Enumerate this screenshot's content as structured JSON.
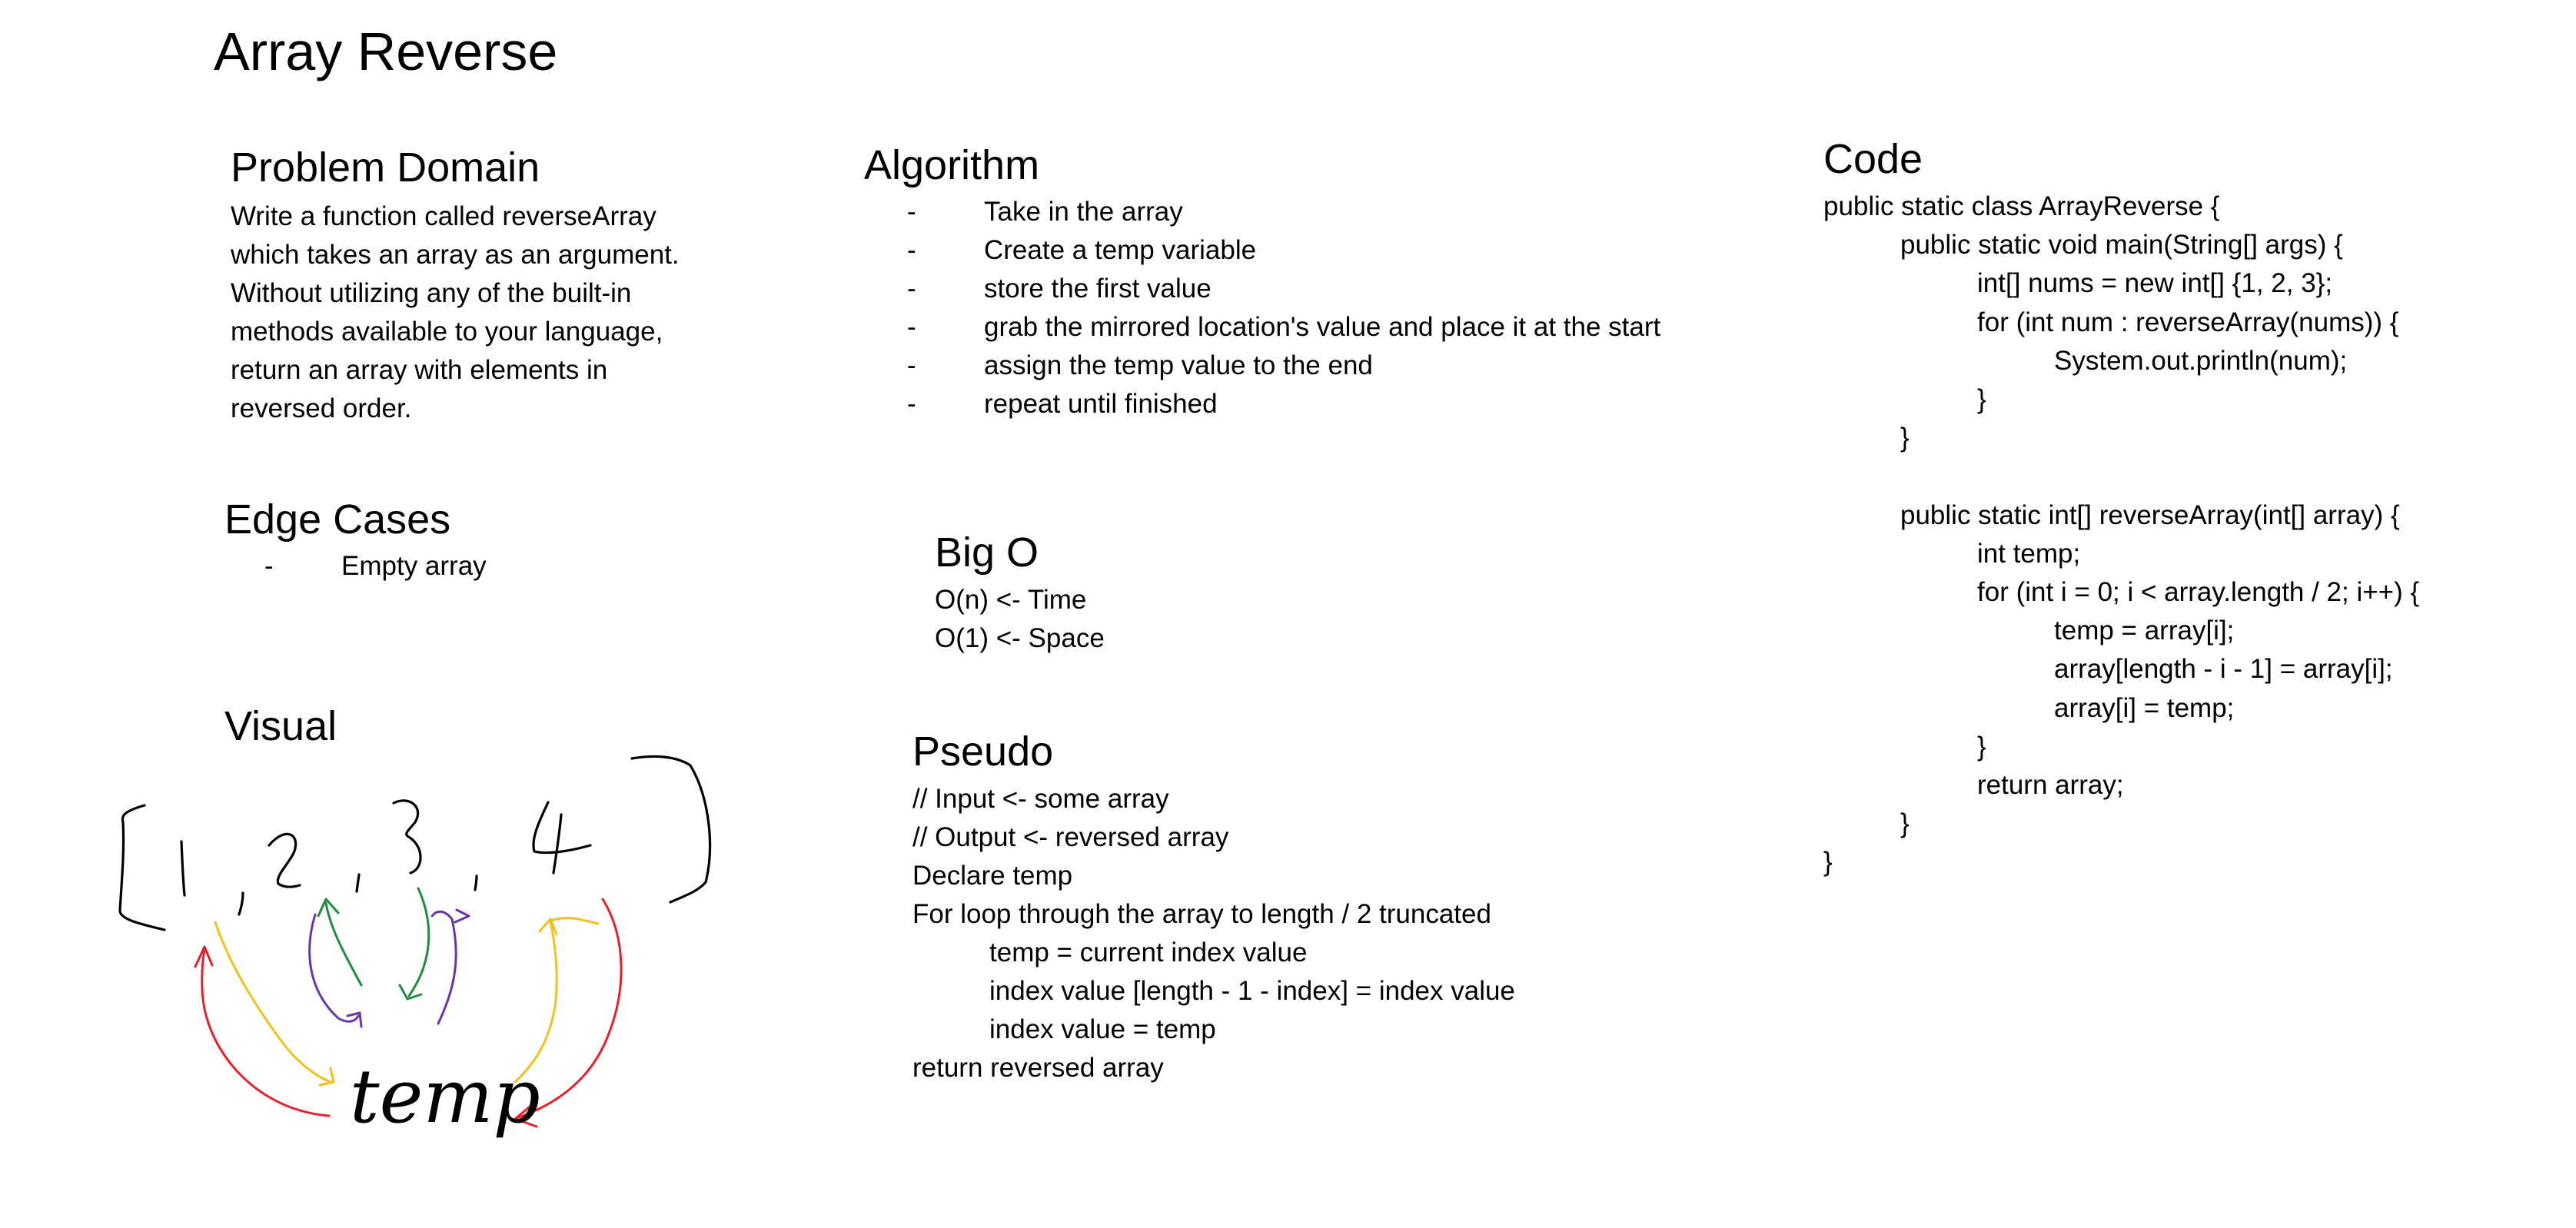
{
  "title": "Array Reverse",
  "problem_domain": {
    "heading": "Problem Domain",
    "lines": [
      "Write a function called reverseArray",
      "which takes an array as an argument.",
      "Without utilizing any of the built-in",
      "methods available to your language,",
      "return an array with elements in",
      "reversed order."
    ]
  },
  "edge_cases": {
    "heading": "Edge Cases",
    "items": [
      "Empty array"
    ]
  },
  "visual": {
    "heading": "Visual",
    "handwritten_label": "temp",
    "colors": {
      "ink": "#000000",
      "red": "#e8202c",
      "yellow": "#f2c21b",
      "purple": "#6a35a8",
      "green": "#1e8e3e"
    }
  },
  "algorithm": {
    "heading": "Algorithm",
    "steps": [
      "Take in the array",
      "Create a temp variable",
      "store the first value",
      "grab the mirrored location's value and place it at the start",
      "assign the temp value to the end",
      "repeat until finished"
    ]
  },
  "big_o": {
    "heading": "Big O",
    "time": "O(n) <- Time",
    "space": "O(1) <- Space"
  },
  "pseudo": {
    "heading": "Pseudo",
    "lines": [
      "// Input <- some array",
      "// Output <- reversed array",
      "Declare temp",
      "For loop through the array to length / 2 truncated",
      "temp = current index value",
      "index value [length - 1 - index] = index value",
      "index value = temp",
      "return reversed array"
    ]
  },
  "code": {
    "heading": "Code",
    "lines": [
      "public static class ArrayReverse {",
      "public static void main(String[] args) {",
      "int[] nums = new int[] {1, 2, 3};",
      "for (int num : reverseArray(nums)) {",
      "System.out.println(num);",
      "}",
      "}",
      "",
      "public static int[] reverseArray(int[] array) {",
      "int temp;",
      "for (int i = 0; i < array.length / 2; i++) {",
      "temp = array[i];",
      "array[length - i - 1] = array[i];",
      "array[i] = temp;",
      "}",
      "return array;",
      "}",
      "}"
    ]
  }
}
